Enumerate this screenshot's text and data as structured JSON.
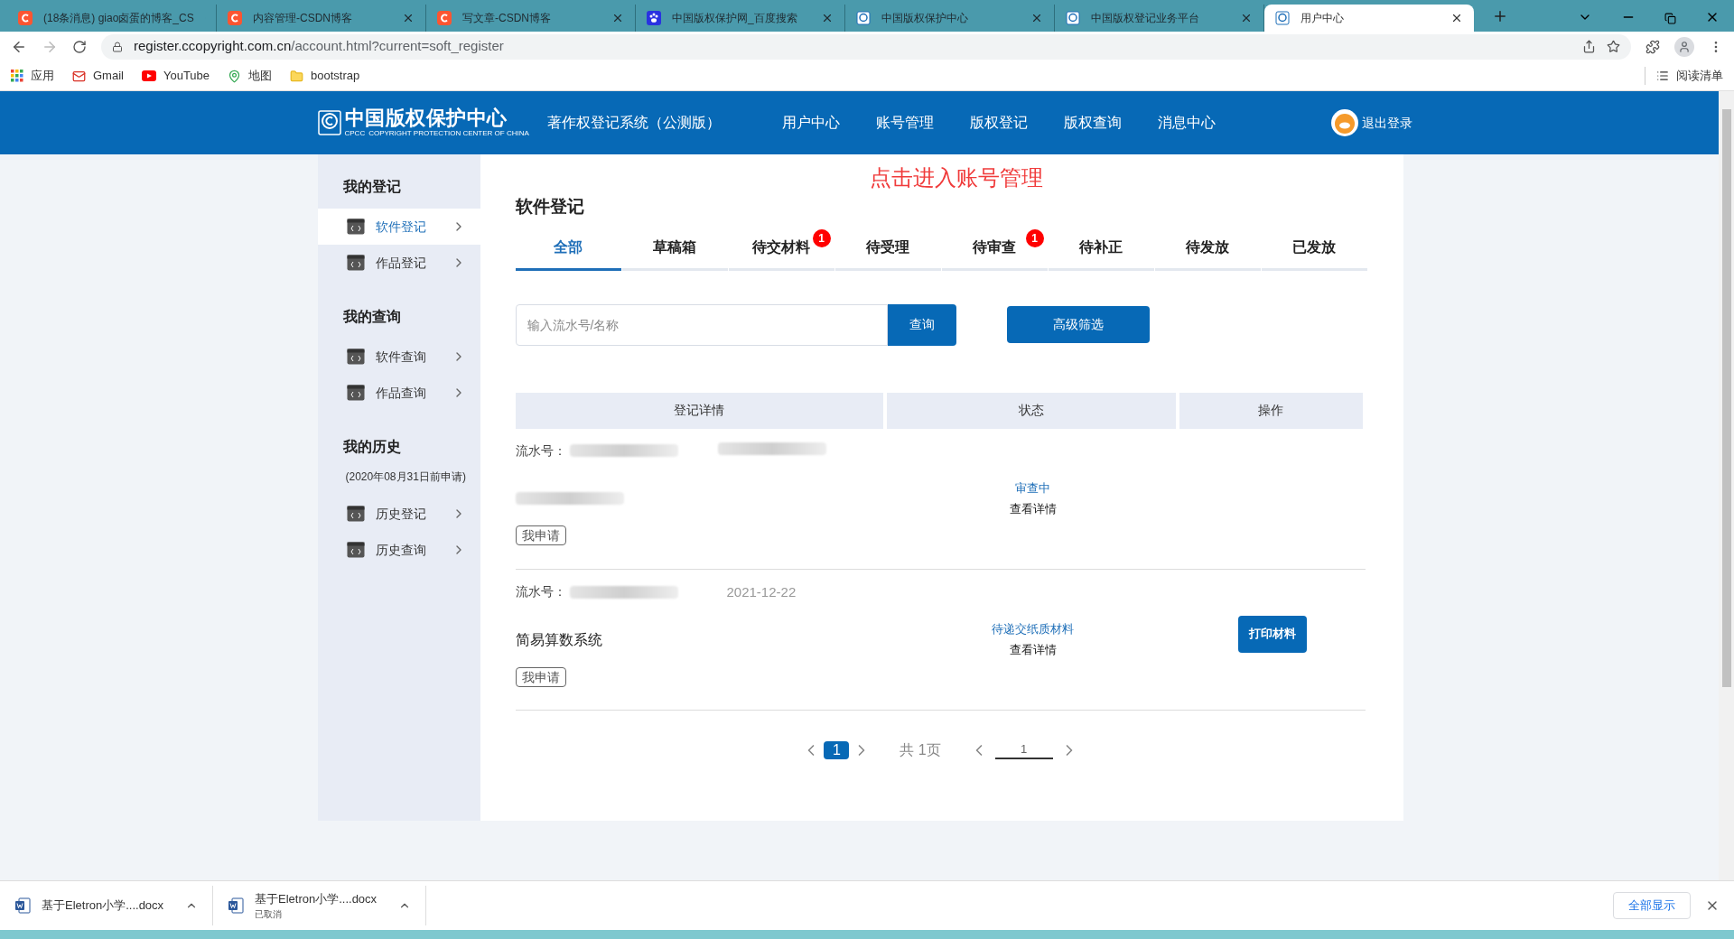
{
  "browser": {
    "tabs": [
      {
        "title": "(18条消息) giao卤蛋的博客_CS",
        "kind": "csdn",
        "selected": false
      },
      {
        "title": "内容管理-CSDN博客",
        "kind": "csdn",
        "selected": false
      },
      {
        "title": "写文章-CSDN博客",
        "kind": "csdn",
        "selected": false
      },
      {
        "title": "中国版权保护网_百度搜索",
        "kind": "paw",
        "selected": false
      },
      {
        "title": "中国版权保护中心",
        "kind": "copyright",
        "selected": false
      },
      {
        "title": "中国版权登记业务平台",
        "kind": "copyright",
        "selected": false
      },
      {
        "title": "用户中心",
        "kind": "copyright",
        "selected": true
      }
    ],
    "address_host": "register.ccopyright.com.cn",
    "address_path": "/account.html?current=soft_register",
    "bookmarks": [
      {
        "label": "应用",
        "kind": "apps"
      },
      {
        "label": "Gmail",
        "kind": "mail"
      },
      {
        "label": "YouTube",
        "kind": "video"
      },
      {
        "label": "地图",
        "kind": "map"
      },
      {
        "label": "bootstrap",
        "kind": "folder"
      }
    ],
    "reading_list": "阅读清单"
  },
  "site_header": {
    "logo_cn": "中国版权保护中心",
    "logo_en": "COPYRIGHT PROTECTION CENTER OF CHINA",
    "logo_mark": "CPCC",
    "system_name": "著作权登记系统（公测版）",
    "nav": [
      "用户中心",
      "账号管理",
      "版权登记",
      "版权查询",
      "消息中心"
    ],
    "logout": "退出登录"
  },
  "sidebar": {
    "sections": [
      {
        "title": "我的登记",
        "items": [
          {
            "label": "软件登记",
            "selected": true
          },
          {
            "label": "作品登记",
            "selected": false
          }
        ]
      },
      {
        "title": "我的查询",
        "items": [
          {
            "label": "软件查询",
            "selected": false
          },
          {
            "label": "作品查询",
            "selected": false
          }
        ]
      },
      {
        "title": "我的历史",
        "note": "(2020年08月31日前申请)",
        "items": [
          {
            "label": "历史登记",
            "selected": false
          },
          {
            "label": "历史查询",
            "selected": false
          }
        ]
      }
    ]
  },
  "annotation": "点击进入账号管理",
  "main": {
    "title": "软件登记",
    "tabs": [
      {
        "label": "全部",
        "selected": true
      },
      {
        "label": "草稿箱",
        "selected": false
      },
      {
        "label": "待交材料",
        "selected": false,
        "badge": "1"
      },
      {
        "label": "待受理",
        "selected": false
      },
      {
        "label": "待审查",
        "selected": false,
        "badge": "1"
      },
      {
        "label": "待补正",
        "selected": false
      },
      {
        "label": "待发放",
        "selected": false
      },
      {
        "label": "已发放",
        "selected": false
      }
    ],
    "search": {
      "placeholder": "输入流水号/名称",
      "button": "查询"
    },
    "filter_button": "高级筛选",
    "table": {
      "columns": [
        "登记详情",
        "状态",
        "操作"
      ],
      "rows": [
        {
          "serial_label": "流水号：",
          "tag": "我申请",
          "status": "审查中",
          "detail": "查看详情"
        },
        {
          "serial_label": "流水号：",
          "date": "2021-12-22",
          "name": "简易算数系统",
          "tag": "我申请",
          "status": "待递交纸质材料",
          "detail": "查看详情",
          "action": "打印材料"
        }
      ]
    },
    "pagination": {
      "pages": [
        {
          "label": "1",
          "selected": true
        }
      ],
      "total": "共 1页",
      "jump_value": "1"
    }
  },
  "downloads": {
    "items": [
      {
        "name": "基于Eletron小学....docx"
      },
      {
        "name": "基于Eletron小学....docx",
        "status": "已取消"
      }
    ],
    "show_all": "全部显示"
  }
}
